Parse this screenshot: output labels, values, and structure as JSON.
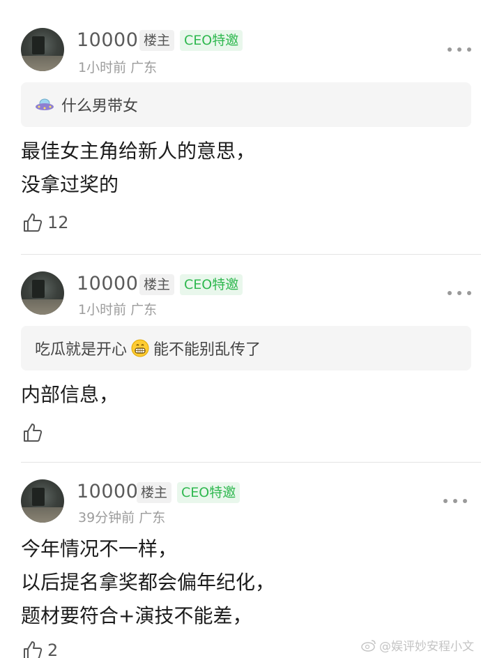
{
  "comments": [
    {
      "username": "10000",
      "host_badge": "楼主",
      "ceo_badge": "CEO特邀",
      "meta": "1小时前 广东",
      "quote": "什么男带女",
      "quote_icon": "ufo-icon",
      "body_lines": [
        "最佳女主角给新人的意思，",
        "没拿过奖的"
      ],
      "likes": "12"
    },
    {
      "username": "10000",
      "host_badge": "楼主",
      "ceo_badge": "CEO特邀",
      "meta": "1小时前 广东",
      "quote_before": "吃瓜就是开心",
      "quote_icon": "grin-emoji-icon",
      "quote_after": "能不能别乱传了",
      "body_lines": [
        "内部信息，"
      ],
      "likes": ""
    },
    {
      "username": "10000",
      "host_badge": "楼主",
      "ceo_badge": "CEO特邀",
      "meta": "39分钟前 广东",
      "body_lines": [
        "今年情况不一样，",
        "以后提名拿奖都会偏年纪化，",
        "题材要符合+演技不能差，"
      ],
      "likes": "2"
    }
  ],
  "watermark": "@娱评妙安程小文"
}
